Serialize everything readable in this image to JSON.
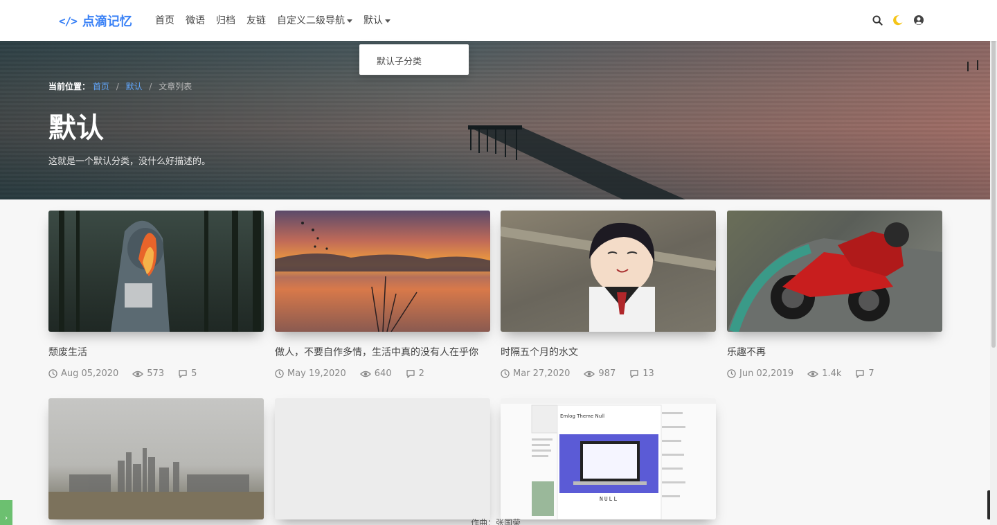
{
  "nav": {
    "logo_code": "</>",
    "logo_text": "点滴记忆",
    "items": [
      {
        "label": "首页",
        "dropdown": false
      },
      {
        "label": "微语",
        "dropdown": false
      },
      {
        "label": "归档",
        "dropdown": false
      },
      {
        "label": "友链",
        "dropdown": false
      },
      {
        "label": "自定义二级导航",
        "dropdown": true
      },
      {
        "label": "默认",
        "dropdown": true
      }
    ],
    "icons": [
      "search-icon",
      "moon-icon",
      "user-icon"
    ],
    "accent": "#3b82f6",
    "moon_color": "#f5c518"
  },
  "dropdown": {
    "item": "默认子分类"
  },
  "hero": {
    "crumb_label": "当前位置：",
    "crumb_home": "首页",
    "crumb_cat": "默认",
    "crumb_current": "文章列表",
    "title": "默认",
    "desc": "这就是一个默认分类，没什么好描述的。"
  },
  "cards": [
    {
      "title": "颓废生活",
      "date": "Aug 05,2020",
      "views": "573",
      "comments": "5"
    },
    {
      "title": "做人，不要自作多情，生活中真的没有人在乎你",
      "date": "May 19,2020",
      "views": "640",
      "comments": "2"
    },
    {
      "title": "时隔五个月的水文",
      "date": "Mar 27,2020",
      "views": "987",
      "comments": "13"
    },
    {
      "title": "乐趣不再",
      "date": "Jun 02,2019",
      "views": "1.4k",
      "comments": "7"
    },
    {
      "title": "",
      "date": "",
      "views": "",
      "comments": ""
    },
    {
      "title": "",
      "date": "",
      "views": "",
      "comments": ""
    },
    {
      "title": "",
      "date": "",
      "views": "",
      "comments": ""
    }
  ],
  "screenshot_text": {
    "title": "Emlog Theme Null",
    "laptop_label": "NULL"
  },
  "footer": {
    "text": "作曲：张国荣"
  },
  "side_button": {
    "label": "›"
  }
}
